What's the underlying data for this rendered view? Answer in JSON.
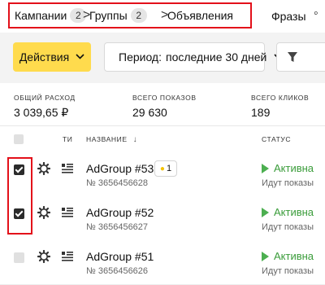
{
  "breadcrumbs": [
    {
      "label": "Кампании",
      "count": "2"
    },
    {
      "label": "Группы",
      "count": "2"
    },
    {
      "label": "Объявления"
    }
  ],
  "breadcrumb_separator": ">",
  "tabs": {
    "phrases": "Фразы"
  },
  "toolbar": {
    "actions_label": "Действия",
    "period_label": "Период:",
    "period_value": "последние 30 дней"
  },
  "stats": [
    {
      "label": "ОБЩИЙ РАСХОД",
      "value": "3 039,65 ₽"
    },
    {
      "label": "ВСЕГО ПОКАЗОВ",
      "value": "29 630"
    },
    {
      "label": "ВСЕГО КЛИКОВ",
      "value": "189"
    }
  ],
  "table": {
    "headers": {
      "type": "ТИ",
      "name": "НАЗВАНИЕ",
      "status": "СТАТУС"
    },
    "rows": [
      {
        "name": "AdGroup #53",
        "id": "№ 3656456628",
        "checked": true,
        "bulb_count": "1",
        "status": "Активна",
        "substatus": "Идут показы"
      },
      {
        "name": "AdGroup #52",
        "id": "№ 3656456627",
        "checked": true,
        "status": "Активна",
        "substatus": "Идут показы"
      },
      {
        "name": "AdGroup #51",
        "id": "№ 3656456626",
        "checked": false,
        "status": "Активна",
        "substatus": "Идут показы"
      }
    ]
  },
  "colors": {
    "accent_yellow": "#ffdb4d",
    "status_green": "#3a9c3a",
    "highlight_red": "#e3101a"
  },
  "icons": [
    "chevron-down-icon",
    "filter-icon",
    "gear-icon",
    "list-type-icon",
    "lightbulb-icon",
    "play-icon",
    "sort-arrow-icon"
  ]
}
